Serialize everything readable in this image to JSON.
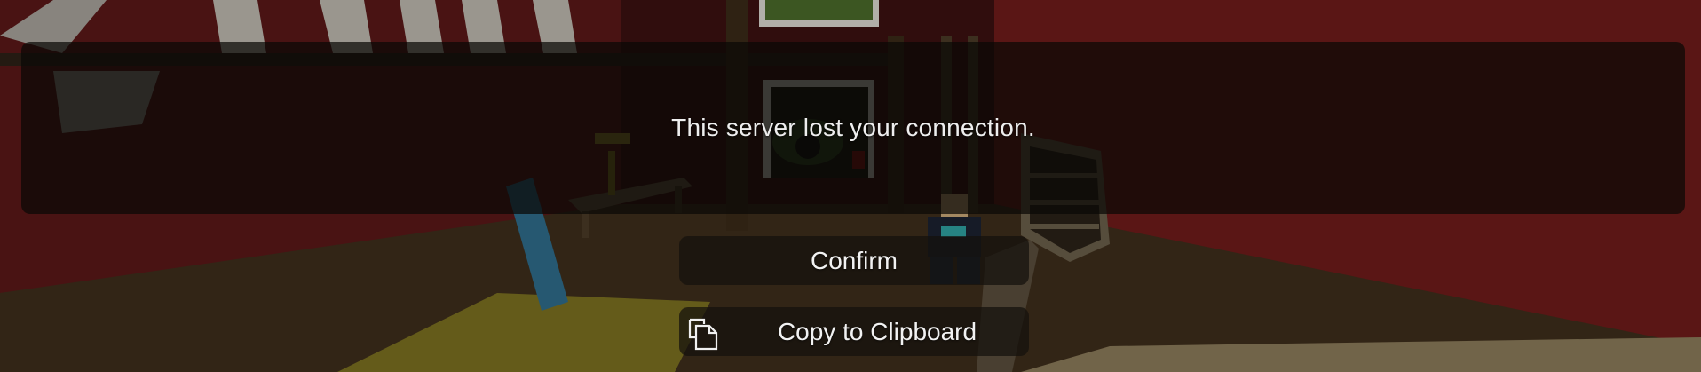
{
  "dialog": {
    "message": "This server lost your connection."
  },
  "buttons": {
    "confirm_label": "Confirm",
    "copy_label": "Copy to Clipboard",
    "copy_icon": "copy-icon"
  },
  "colors": {
    "panel_background": "#0a0806",
    "text": "#eeeeee",
    "wall_red": "#6e1b1a"
  }
}
